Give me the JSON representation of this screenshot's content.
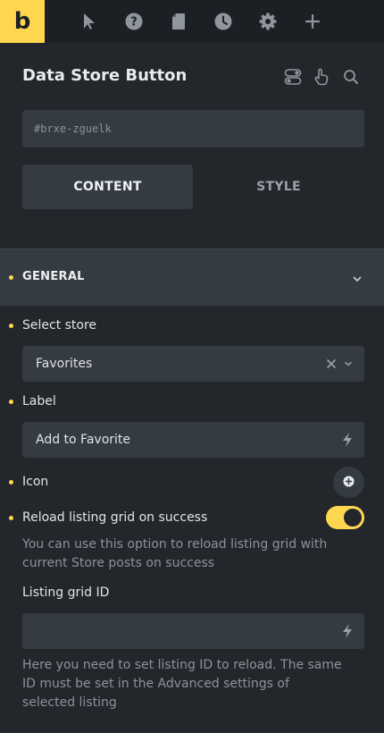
{
  "app": {
    "logo_text": "b"
  },
  "toolbar": {
    "icons": [
      "pointer-icon",
      "help-icon",
      "page-icon",
      "history-icon",
      "settings-icon",
      "add-icon"
    ]
  },
  "panel": {
    "title": "Data Store Button",
    "element_id": "#brxe-zguelk",
    "tabs": [
      {
        "label": "CONTENT",
        "active": true
      },
      {
        "label": "STYLE",
        "active": false
      }
    ]
  },
  "section": {
    "label": "GENERAL",
    "expanded": true
  },
  "controls": {
    "select_store": {
      "label": "Select store",
      "value": "Favorites"
    },
    "label": {
      "label": "Label",
      "value": "Add to Favorite"
    },
    "icon": {
      "label": "Icon"
    },
    "reload": {
      "label": "Reload listing grid on success",
      "enabled": true,
      "help": "You can use this option to reload listing grid with current Store posts on success"
    },
    "listing_grid_id": {
      "label": "Listing grid ID",
      "value": "",
      "help": "Here you need to set listing ID to reload. The same ID must be set in the Advanced settings of selected listing"
    }
  },
  "colors": {
    "accent": "#ffd64f",
    "background": "#23272b",
    "topbar": "#1c1f23",
    "field": "#353b42",
    "muted_text": "#8b939b"
  }
}
